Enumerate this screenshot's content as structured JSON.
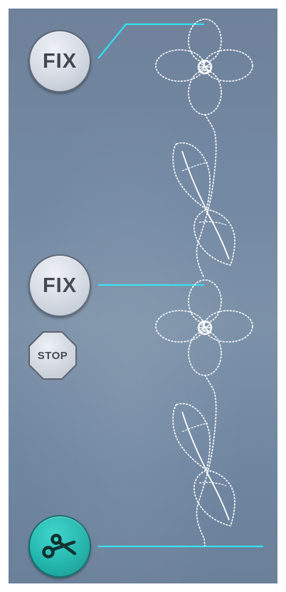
{
  "colors": {
    "panel_bg": "#748aa4",
    "leader_line": "#33e0f0",
    "stitch": "#ffffff",
    "fix_button": "#d8dde6",
    "cut_button": "#23b5ad"
  },
  "commands": {
    "fix_top": {
      "label": "FIX",
      "icon": "fix-button"
    },
    "fix_middle": {
      "label": "FIX",
      "icon": "fix-button"
    },
    "stop": {
      "label": "STOP",
      "icon": "stop-octagon"
    },
    "thread_cut": {
      "icon": "scissors-icon"
    }
  },
  "stitch_design": {
    "motif": "flower-and-leaves",
    "repeats": 2
  }
}
